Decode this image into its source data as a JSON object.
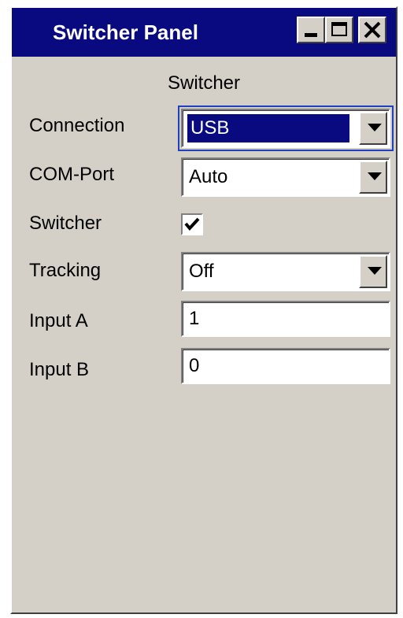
{
  "window": {
    "title": "Switcher Panel",
    "buttons": [
      "minimize-icon",
      "maximize-icon",
      "close-icon"
    ]
  },
  "section_header": "Switcher",
  "fields": {
    "connection": {
      "label": "Connection",
      "value": "USB"
    },
    "com_port": {
      "label": "COM-Port",
      "value": "Auto"
    },
    "switcher": {
      "label": "Switcher",
      "checked": true
    },
    "tracking": {
      "label": "Tracking",
      "value": "Off"
    },
    "input_a": {
      "label": "Input A",
      "value": "1"
    },
    "input_b": {
      "label": "Input B",
      "value": "0"
    }
  },
  "colors": {
    "titlebar": "#0a0a80",
    "panel": "#d4d0c8",
    "selection": "#0a0a80"
  }
}
